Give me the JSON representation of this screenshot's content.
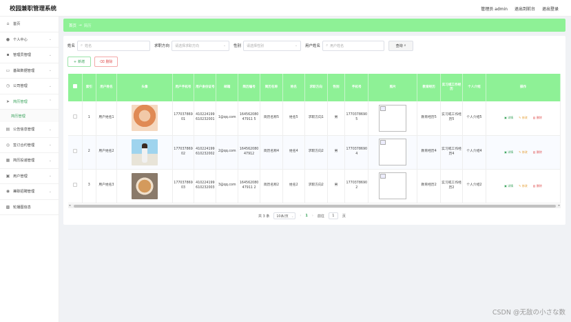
{
  "header": {
    "app_title": "校园兼职管理系统",
    "user": "管理员 admin",
    "goto_front": "退出到前台",
    "logout": "退出登录"
  },
  "sidebar": {
    "items": [
      {
        "label": "首页",
        "icon": "home-icon"
      },
      {
        "label": "个人中心",
        "icon": "user-icon"
      },
      {
        "label": "管理员管理",
        "icon": "admin-icon"
      },
      {
        "label": "基础数据管理",
        "icon": "database-icon"
      },
      {
        "label": "公司管理",
        "icon": "company-icon"
      },
      {
        "label": "简历管理",
        "icon": "send-icon"
      },
      {
        "label": "公告信息管理",
        "icon": "notice-icon"
      },
      {
        "label": "签订合约管理",
        "icon": "contract-icon"
      },
      {
        "label": "简历投递管理",
        "icon": "delivery-icon"
      },
      {
        "label": "用户管理",
        "icon": "users-icon"
      },
      {
        "label": "兼职招聘管理",
        "icon": "recruit-icon"
      },
      {
        "label": "轮播图信息",
        "icon": "image-icon"
      }
    ],
    "active_sub": "简历管理"
  },
  "breadcrumb": {
    "home": "首页",
    "current": "简历"
  },
  "search": {
    "name_label": "姓名",
    "name_placeholder": "姓名",
    "direction_label": "求职方向",
    "direction_placeholder": "请选择求职方向",
    "gender_label": "性别",
    "gender_placeholder": "请选择性别",
    "username_label": "用户姓名",
    "username_placeholder": "用户姓名",
    "query_label": "查询"
  },
  "actions": {
    "add": "新增",
    "delete": "删除"
  },
  "table": {
    "headers": [
      "索引",
      "用户姓名",
      "头像",
      "用户手机号",
      "用户身份证号",
      "邮箱",
      "简历编号",
      "简历名称",
      "姓名",
      "求职方向",
      "性别",
      "手机号",
      "照片",
      "教育经历",
      "实习或工作经历",
      "个人介绍",
      "操作"
    ],
    "rows": [
      {
        "index": "1",
        "username": "用户姓名1",
        "phone": "17703786901",
        "idcard": "410224199610232001",
        "email": "1@qq.com",
        "resume_no": "16456208047911 5",
        "resume_name": "简历名称5",
        "name": "姓名5",
        "direction": "求职方向1",
        "gender": "男",
        "mobile": "17703786905",
        "edu": "教育经历5",
        "work": "实习或工作经历5",
        "intro": "个人介绍5"
      },
      {
        "index": "2",
        "username": "用户姓名2",
        "phone": "17703786902",
        "idcard": "410224199610232002",
        "email": "2@qq.com",
        "resume_no": "16456208047912",
        "resume_name": "简历名称4",
        "name": "姓名4",
        "direction": "求职方向2",
        "gender": "男",
        "mobile": "17703786904",
        "edu": "教育经历4",
        "work": "实习或工作经历4",
        "intro": "个人介绍4"
      },
      {
        "index": "3",
        "username": "用户姓名3",
        "phone": "17703786903",
        "idcard": "410224199610232003",
        "email": "3@qq.com",
        "resume_no": "16456208047911 2",
        "resume_name": "简历名称2",
        "name": "姓名2",
        "direction": "求职方向2",
        "gender": "男",
        "mobile": "17703786902",
        "edu": "教育经历2",
        "work": "实习或工作经历2",
        "intro": "个人介绍2"
      }
    ],
    "ops": {
      "view": "详情",
      "edit": "修改",
      "delete": "删除"
    }
  },
  "pager": {
    "total": "共 3 条",
    "size": "10条/页",
    "page": "1",
    "goto": "前往",
    "jump_value": "1",
    "page_unit": "页"
  },
  "watermark": "CSDN @无敌の小さな数"
}
